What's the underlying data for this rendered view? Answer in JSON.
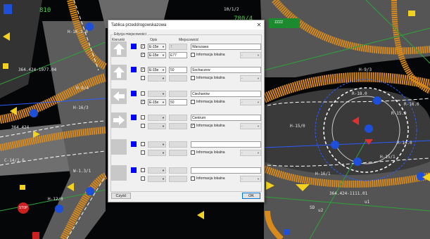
{
  "cad": {
    "labels": [
      "810",
      "H-1K.3.0",
      "10/1/2",
      "780/4",
      "364.424-1077.04",
      "364.424",
      "H-16/3",
      "H-9/4",
      "H-9/3",
      "R-18.0",
      "R-16.0",
      "R-15.0",
      "R-14.0",
      "H-15/1",
      "H-16/1",
      "H-15/0",
      "364.424-1111.01",
      "C-14/1.6",
      "W-1.3/1",
      "H-12/0",
      "STOP",
      "SD",
      "u2",
      "u1"
    ],
    "sign_text": "ZZZZ"
  },
  "dialog": {
    "title": "Tablica przeddrogowskazowa",
    "close_glyph": "✕",
    "group_label": "Edycja miejscowości",
    "headers": {
      "direction": "Kierunki",
      "route": "Opis",
      "place": "Miejscowość"
    },
    "info_label": "Informacja lokalna",
    "rows": [
      {
        "arrow": "up",
        "lines": [
          {
            "checked": true,
            "route": "E-15e",
            "route_enabled": true,
            "distance": "7",
            "distance_enabled": false,
            "place": "Warszawa",
            "info": false
          },
          {
            "checked": true,
            "route": "E-15e",
            "route_enabled": true,
            "distance": "E77",
            "distance_enabled": true,
            "place": "",
            "info": false,
            "info_value": "-"
          }
        ]
      },
      {
        "arrow": "up",
        "lines": [
          {
            "checked": true,
            "route": "E-15e",
            "route_enabled": true,
            "distance": "50",
            "distance_enabled": true,
            "place": "Sochaczew",
            "info": false
          },
          {
            "checked": false,
            "route": "",
            "route_enabled": false,
            "distance": "",
            "distance_enabled": false,
            "place": "",
            "info": false,
            "info_value": "-"
          }
        ]
      },
      {
        "arrow": "left",
        "lines": [
          {
            "checked": false,
            "route": "",
            "route_enabled": false,
            "distance": "",
            "distance_enabled": false,
            "place": "Ciechanów",
            "info": false
          },
          {
            "checked": true,
            "route": "E-15e",
            "route_enabled": true,
            "distance": "50",
            "distance_enabled": true,
            "place": "",
            "info": false,
            "info_value": "-"
          }
        ]
      },
      {
        "arrow": "right",
        "lines": [
          {
            "checked": false,
            "route": "",
            "route_enabled": false,
            "distance": "",
            "distance_enabled": false,
            "place": "Centrum",
            "info": false
          },
          {
            "checked": false,
            "route": "",
            "route_enabled": false,
            "distance": "",
            "distance_enabled": false,
            "place": "",
            "info": true,
            "info_value": "-"
          }
        ]
      },
      {
        "arrow": "none",
        "lines": [
          {
            "checked": false,
            "route": "",
            "route_enabled": false,
            "distance": "",
            "distance_enabled": false,
            "place": "",
            "info": false
          },
          {
            "checked": false,
            "route": "",
            "route_enabled": false,
            "distance": "",
            "distance_enabled": false,
            "place": "",
            "info": false,
            "info_value": "-"
          }
        ]
      },
      {
        "arrow": "none",
        "lines": [
          {
            "checked": false,
            "route": "",
            "route_enabled": false,
            "distance": "",
            "distance_enabled": false,
            "place": "",
            "info": false
          },
          {
            "checked": false,
            "route": "",
            "route_enabled": false,
            "distance": "",
            "distance_enabled": false,
            "place": "",
            "info": false,
            "info_value": "-"
          }
        ]
      }
    ],
    "clear_label": "Czyść",
    "ok_label": "OK"
  }
}
